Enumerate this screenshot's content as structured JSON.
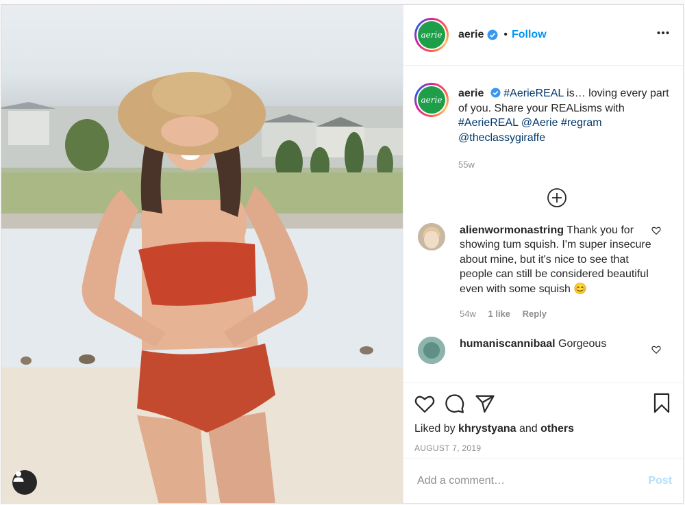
{
  "header": {
    "username": "aerie",
    "separator": "•",
    "follow_label": "Follow",
    "avatar_text": "aerie",
    "more_icon": "more-horizontal-icon"
  },
  "caption": {
    "username": "aerie",
    "parts": [
      {
        "text": "#AerieREAL",
        "link": true
      },
      {
        "text": " is… loving every part of you. Share your REALisms with ",
        "link": false
      },
      {
        "text": "#AerieREAL",
        "link": true
      },
      {
        "text": " ",
        "link": false
      },
      {
        "text": "@Aerie",
        "link": true
      },
      {
        "text": " ",
        "link": false
      },
      {
        "text": "#regram",
        "link": true
      },
      {
        "text": " ",
        "link": false
      },
      {
        "text": "@theclassygiraffe",
        "link": true
      }
    ],
    "time": "55w"
  },
  "load_more_icon": "plus-circle-icon",
  "comments": [
    {
      "username": "alienwormonastring",
      "text": "Thank you for showing tum squish. I'm super insecure about mine, but it's nice to see that people can still be considered beautiful even with some squish 😊",
      "time": "54w",
      "likes": "1 like",
      "reply_label": "Reply"
    },
    {
      "username": "humaniscannibaal",
      "text": "Gorgeous"
    }
  ],
  "actions": {
    "like_icon": "heart-icon",
    "comment_icon": "comment-icon",
    "share_icon": "paper-plane-icon",
    "save_icon": "bookmark-icon",
    "liked_by_prefix": "Liked by",
    "liked_by_user": "khrystyana",
    "liked_by_and": "and",
    "liked_by_others": "others",
    "date": "AUGUST 7, 2019"
  },
  "comment_box": {
    "placeholder": "Add a comment…",
    "post_label": "Post"
  },
  "colors": {
    "accent": "#0095f6",
    "link": "#00376b",
    "brand_green": "#1f9e4a",
    "swimsuit": "#c8452c"
  }
}
